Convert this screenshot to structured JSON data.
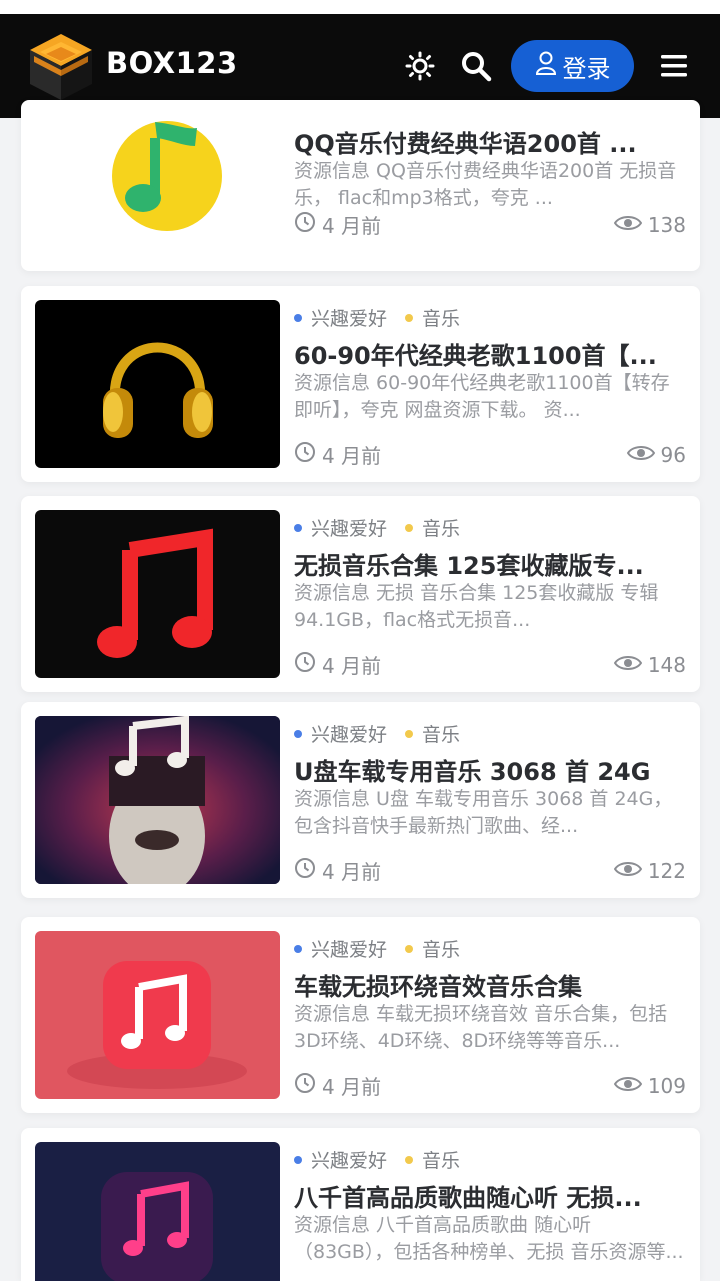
{
  "header": {
    "brand": "BOX123",
    "login_label": "登录",
    "icons": [
      "theme-sun-icon",
      "search-icon",
      "user-icon",
      "menu-icon"
    ],
    "colors": {
      "bg": "#0b0b0b",
      "login": "#1660d4"
    }
  },
  "categories": {
    "hobby": "兴趣爱好",
    "music": "音乐",
    "hobby_color": "#4a7ee6",
    "music_color": "#f2c94c"
  },
  "posts": [
    {
      "title": "QQ音乐付费经典华语200首 ...",
      "desc": "资源信息 QQ音乐付费经典华语200首 无损音乐， flac和mp3格式，夸克 ...",
      "time": "4 月前",
      "views": "138"
    },
    {
      "title": "60-90年代经典老歌1100首【...",
      "desc": "资源信息 60-90年代经典老歌1100首【转存即听】，夸克 网盘资源下载。 资...",
      "time": "4 月前",
      "views": "96"
    },
    {
      "title": "无损音乐合集 125套收藏版专...",
      "desc": "资源信息 无损 音乐合集 125套收藏版 专辑 94.1GB，flac格式无损音...",
      "time": "4 月前",
      "views": "148"
    },
    {
      "title": "U盘车载专用音乐 3068 首 24G",
      "desc": "资源信息 U盘 车载专用音乐 3068 首 24G，包含抖音快手最新热门歌曲、经...",
      "time": "4 月前",
      "views": "122"
    },
    {
      "title": "车载无损环绕音效音乐合集",
      "desc": "资源信息 车载无损环绕音效 音乐合集，包括3D环绕、4D环绕、8D环绕等等音乐...",
      "time": "4 月前",
      "views": "109"
    },
    {
      "title": "八千首高品质歌曲随心听 无损...",
      "desc": "资源信息 八千首高品质歌曲 随心听（83GB），包括各种榜单、无损 音乐资源等...",
      "time": "",
      "views": ""
    }
  ]
}
